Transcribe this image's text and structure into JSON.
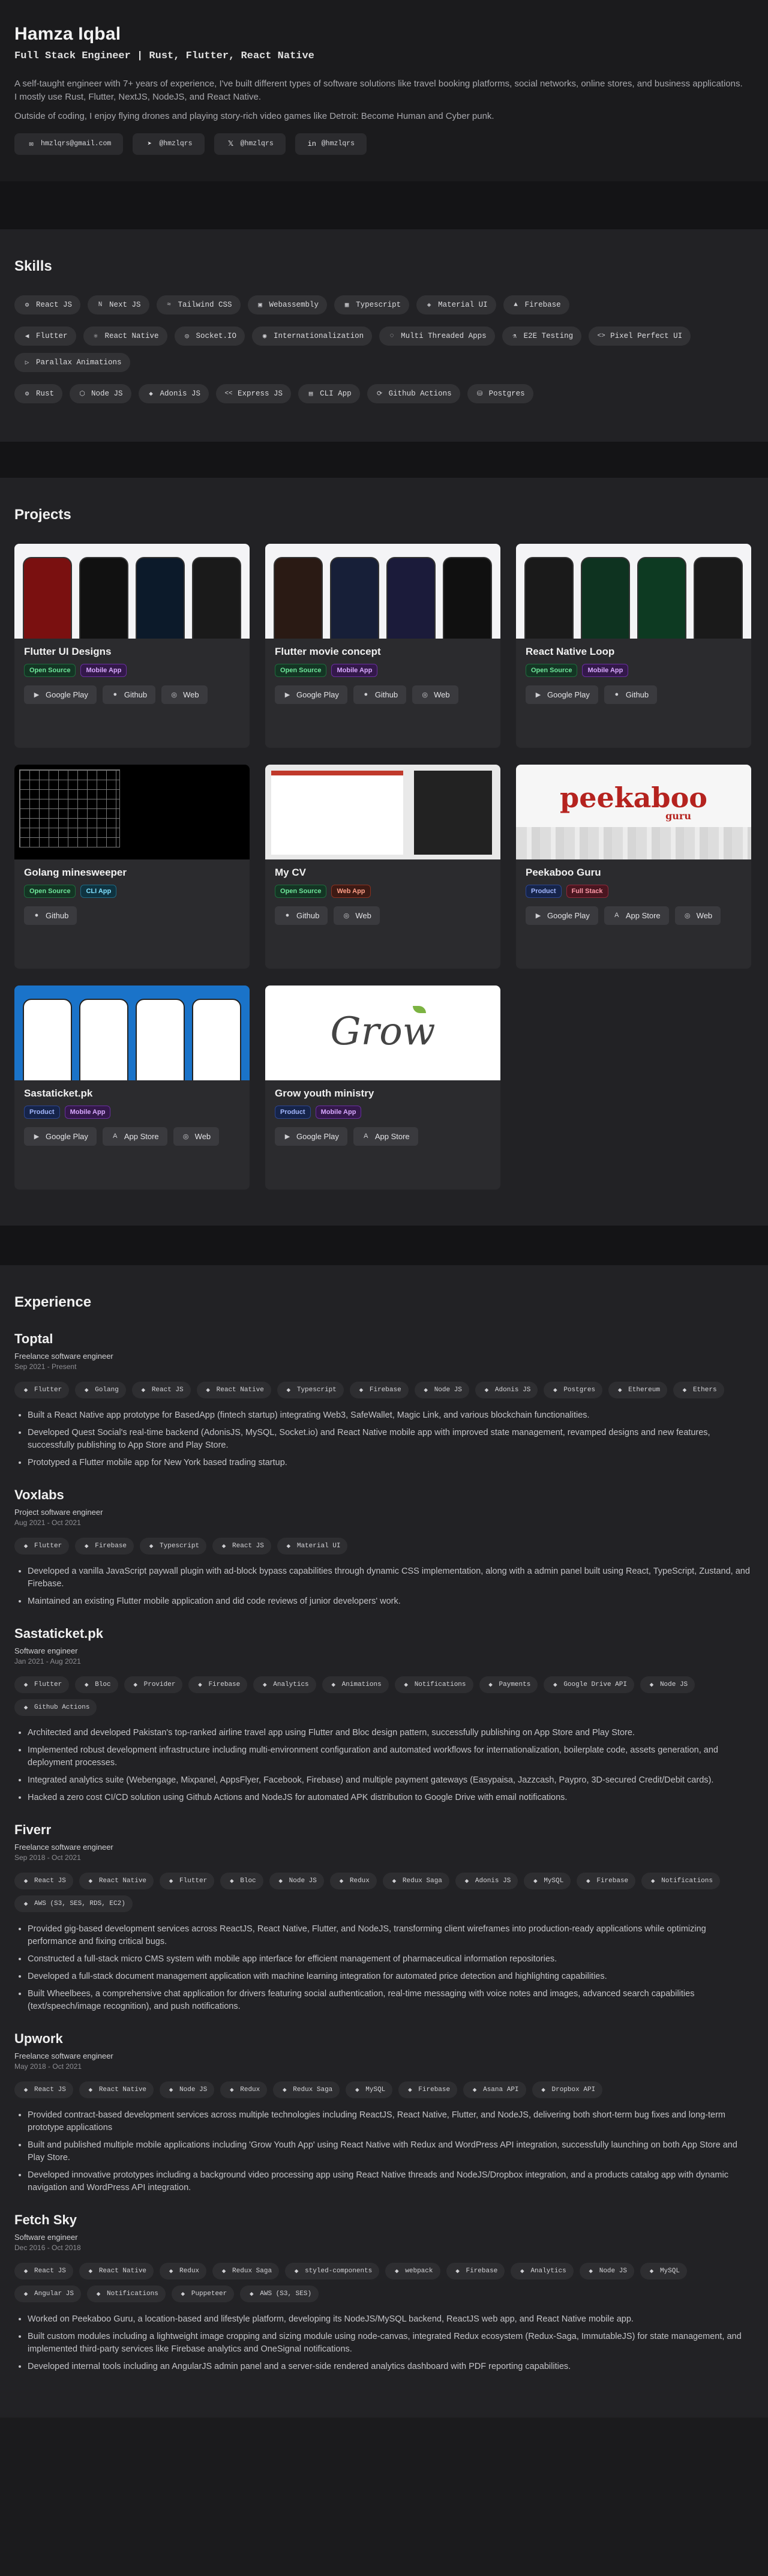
{
  "header": {
    "name": "Hamza Iqbal",
    "tagline": "Full Stack Engineer | Rust, Flutter, React Native",
    "bio": "A self-taught engineer with 7+ years of experience, I've built different types of software solutions like travel booking platforms, social networks, online stores, and business applications. I mostly use Rust, Flutter, NextJS, NodeJS, and React Native.",
    "bio2": "Outside of coding, I enjoy flying drones and playing story-rich video games like Detroit: Become Human and Cyber punk.",
    "contacts": [
      {
        "icon": "mail-icon",
        "glyph": "✉",
        "label": "hmzlqrs@gmail.com"
      },
      {
        "icon": "telegram-icon",
        "glyph": "➤",
        "label": "@hmzlqrs"
      },
      {
        "icon": "x-icon",
        "glyph": "𝕏",
        "label": "@hmzlqrs"
      },
      {
        "icon": "linkedin-icon",
        "glyph": "in",
        "label": "@hmzlqrs"
      }
    ]
  },
  "skills": {
    "title": "Skills",
    "rows": [
      [
        {
          "icon": "rust-icon",
          "glyph": "⚙",
          "label": "React JS"
        },
        {
          "icon": "next-icon",
          "glyph": "N",
          "label": "Next JS"
        },
        {
          "icon": "tailwind-icon",
          "glyph": "≈",
          "label": "Tailwind CSS"
        },
        {
          "icon": "wasm-icon",
          "glyph": "▣",
          "label": "Webassembly"
        },
        {
          "icon": "ts-icon",
          "glyph": "▦",
          "label": "Typescript"
        },
        {
          "icon": "mui-icon",
          "glyph": "◈",
          "label": "Material UI"
        },
        {
          "icon": "firebase-icon",
          "glyph": "▲",
          "label": "Firebase"
        }
      ],
      [
        {
          "icon": "flutter-icon",
          "glyph": "◀",
          "label": "Flutter"
        },
        {
          "icon": "react-icon",
          "glyph": "⚛",
          "label": "React Native"
        },
        {
          "icon": "socket-icon",
          "glyph": "◎",
          "label": "Socket.IO"
        },
        {
          "icon": "i18n-icon",
          "glyph": "◉",
          "label": "Internationalization"
        },
        {
          "icon": "threads-icon",
          "glyph": "◌",
          "label": "Multi Threaded Apps"
        },
        {
          "icon": "flask-icon",
          "glyph": "⚗",
          "label": "E2E Testing"
        },
        {
          "icon": "code-icon",
          "glyph": "<>",
          "label": "Pixel Perfect UI"
        },
        {
          "icon": "play-icon",
          "glyph": "▷",
          "label": "Parallax Animations"
        }
      ],
      [
        {
          "icon": "rust-icon",
          "glyph": "⚙",
          "label": "Rust"
        },
        {
          "icon": "node-icon",
          "glyph": "⬡",
          "label": "Node JS"
        },
        {
          "icon": "adonis-icon",
          "glyph": "◆",
          "label": "Adonis JS"
        },
        {
          "icon": "express-icon",
          "glyph": "<<",
          "label": "Express JS"
        },
        {
          "icon": "cli-icon",
          "glyph": "▤",
          "label": "CLI App"
        },
        {
          "icon": "gh-actions-icon",
          "glyph": "⟳",
          "label": "Github Actions"
        },
        {
          "icon": "postgres-icon",
          "glyph": "⛁",
          "label": "Postgres"
        }
      ]
    ]
  },
  "projects": {
    "title": "Projects",
    "items": [
      {
        "title": "Flutter UI Designs",
        "thumb": "phones",
        "tags": [
          {
            "cls": "os",
            "label": "Open Source"
          },
          {
            "cls": "mob",
            "label": "Mobile App"
          }
        ],
        "buttons": [
          {
            "icon": "play-store-icon",
            "glyph": "▶",
            "label": "Google Play"
          },
          {
            "icon": "github-icon",
            "glyph": "●",
            "label": "Github"
          },
          {
            "icon": "web-icon",
            "glyph": "◎",
            "label": "Web"
          }
        ]
      },
      {
        "title": "Flutter movie concept",
        "thumb": "phones2",
        "tags": [
          {
            "cls": "os",
            "label": "Open Source"
          },
          {
            "cls": "mob",
            "label": "Mobile App"
          }
        ],
        "buttons": [
          {
            "icon": "play-store-icon",
            "glyph": "▶",
            "label": "Google Play"
          },
          {
            "icon": "github-icon",
            "glyph": "●",
            "label": "Github"
          },
          {
            "icon": "web-icon",
            "glyph": "◎",
            "label": "Web"
          }
        ]
      },
      {
        "title": "React Native Loop",
        "thumb": "loop",
        "tags": [
          {
            "cls": "os",
            "label": "Open Source"
          },
          {
            "cls": "mob",
            "label": "Mobile App"
          }
        ],
        "buttons": [
          {
            "icon": "play-store-icon",
            "glyph": "▶",
            "label": "Google Play"
          },
          {
            "icon": "github-icon",
            "glyph": "●",
            "label": "Github"
          }
        ]
      },
      {
        "title": "Golang minesweeper",
        "thumb": "mines",
        "tags": [
          {
            "cls": "os",
            "label": "Open Source"
          },
          {
            "cls": "cli",
            "label": "CLI App"
          }
        ],
        "buttons": [
          {
            "icon": "github-icon",
            "glyph": "●",
            "label": "Github"
          }
        ]
      },
      {
        "title": "My CV",
        "thumb": "cv",
        "tags": [
          {
            "cls": "os",
            "label": "Open Source"
          },
          {
            "cls": "web",
            "label": "Web App"
          }
        ],
        "buttons": [
          {
            "icon": "github-icon",
            "glyph": "●",
            "label": "Github"
          },
          {
            "icon": "web-icon",
            "glyph": "◎",
            "label": "Web"
          }
        ]
      },
      {
        "title": "Peekaboo Guru",
        "thumb": "peekaboo",
        "logo_text": "peekaboo",
        "logo_sub": "guru",
        "tags": [
          {
            "cls": "prod",
            "label": "Product"
          },
          {
            "cls": "full",
            "label": "Full Stack"
          }
        ],
        "buttons": [
          {
            "icon": "play-store-icon",
            "glyph": "▶",
            "label": "Google Play"
          },
          {
            "icon": "app-store-icon",
            "glyph": "A",
            "label": "App Store"
          },
          {
            "icon": "web-icon",
            "glyph": "◎",
            "label": "Web"
          }
        ]
      },
      {
        "title": "Sastaticket.pk",
        "thumb": "sasta",
        "tags": [
          {
            "cls": "prod",
            "label": "Product"
          },
          {
            "cls": "mob",
            "label": "Mobile App"
          }
        ],
        "buttons": [
          {
            "icon": "play-store-icon",
            "glyph": "▶",
            "label": "Google Play"
          },
          {
            "icon": "app-store-icon",
            "glyph": "A",
            "label": "App Store"
          },
          {
            "icon": "web-icon",
            "glyph": "◎",
            "label": "Web"
          }
        ]
      },
      {
        "title": "Grow youth ministry",
        "thumb": "grow",
        "logo_text": "Grow",
        "tags": [
          {
            "cls": "prod",
            "label": "Product"
          },
          {
            "cls": "mob",
            "label": "Mobile App"
          }
        ],
        "buttons": [
          {
            "icon": "play-store-icon",
            "glyph": "▶",
            "label": "Google Play"
          },
          {
            "icon": "app-store-icon",
            "glyph": "A",
            "label": "App Store"
          }
        ]
      }
    ]
  },
  "experience": {
    "title": "Experience",
    "items": [
      {
        "company": "Toptal",
        "role": "Freelance software engineer",
        "dates": "Sep 2021 - Present",
        "chips": [
          "Flutter",
          "Golang",
          "React JS",
          "React Native",
          "Typescript",
          "Firebase",
          "Node JS",
          "Adonis JS",
          "Postgres",
          "Ethereum",
          "Ethers"
        ],
        "bullets": [
          "Built a React Native app prototype for BasedApp (fintech startup) integrating Web3, SafeWallet, Magic Link, and various blockchain functionalities.",
          "Developed Quest Social's real-time backend (AdonisJS, MySQL, Socket.io) and React Native mobile app with improved state management, revamped designs and new features, successfully publishing to App Store and Play Store.",
          "Prototyped a Flutter mobile app for New York based trading startup."
        ]
      },
      {
        "company": "Voxlabs",
        "role": "Project software engineer",
        "dates": "Aug 2021 - Oct 2021",
        "chips": [
          "Flutter",
          "Firebase",
          "Typescript",
          "React JS",
          "Material UI"
        ],
        "bullets": [
          "Developed a vanilla JavaScript paywall plugin with ad-block bypass capabilities through dynamic CSS implementation, along with a admin panel built using React, TypeScript, Zustand, and Firebase.",
          "Maintained an existing Flutter mobile application and did code reviews of junior developers' work."
        ]
      },
      {
        "company": "Sastaticket.pk",
        "role": "Software engineer",
        "dates": "Jan 2021 - Aug 2021",
        "chips": [
          "Flutter",
          "Bloc",
          "Provider",
          "Firebase",
          "Analytics",
          "Animations",
          "Notifications",
          "Payments",
          "Google Drive API",
          "Node JS",
          "Github Actions"
        ],
        "bullets": [
          "Architected and developed Pakistan's top-ranked airline travel app using Flutter and Bloc design pattern, successfully publishing on App Store and Play Store.",
          "Implemented robust development infrastructure including multi-environment configuration and automated workflows for internationalization, boilerplate code, assets generation, and deployment processes.",
          "Integrated analytics suite (Webengage, Mixpanel, AppsFlyer, Facebook, Firebase) and multiple payment gateways (Easypaisa, Jazzcash, Paypro, 3D-secured Credit/Debit cards).",
          "Hacked a zero cost CI/CD solution using Github Actions and NodeJS for automated APK distribution to Google Drive with email notifications."
        ]
      },
      {
        "company": "Fiverr",
        "role": "Freelance software engineer",
        "dates": "Sep 2018 - Oct 2021",
        "chips": [
          "React JS",
          "React Native",
          "Flutter",
          "Bloc",
          "Node JS",
          "Redux",
          "Redux Saga",
          "Adonis JS",
          "MySQL",
          "Firebase",
          "Notifications",
          "AWS (S3, SES, RDS, EC2)"
        ],
        "bullets": [
          "Provided gig-based development services across ReactJS, React Native, Flutter, and NodeJS, transforming client wireframes into production-ready applications while optimizing performance and fixing critical bugs.",
          "Constructed a full-stack micro CMS system with mobile app interface for efficient management of pharmaceutical information repositories.",
          "Developed a full-stack document management application with machine learning integration for automated price detection and highlighting capabilities.",
          "Built Wheelbees, a comprehensive chat application for drivers featuring social authentication, real-time messaging with voice notes and images, advanced search capabilities (text/speech/image recognition), and push notifications."
        ]
      },
      {
        "company": "Upwork",
        "role": "Freelance software engineer",
        "dates": "May 2018 - Oct 2021",
        "chips": [
          "React JS",
          "React Native",
          "Node JS",
          "Redux",
          "Redux Saga",
          "MySQL",
          "Firebase",
          "Asana API",
          "Dropbox API"
        ],
        "bullets": [
          "Provided contract-based development services across multiple technologies including ReactJS, React Native, Flutter, and NodeJS, delivering both short-term bug fixes and long-term prototype applications",
          "Built and published multiple mobile applications including 'Grow Youth App' using React Native with Redux and WordPress API integration, successfully launching on both App Store and Play Store.",
          "Developed innovative prototypes including a background video processing app using React Native threads and NodeJS/Dropbox integration, and a products catalog app with dynamic navigation and WordPress API integration."
        ]
      },
      {
        "company": "Fetch Sky",
        "role": "Software engineer",
        "dates": "Dec 2016 - Oct 2018",
        "chips": [
          "React JS",
          "React Native",
          "Redux",
          "Redux Saga",
          "styled-components",
          "webpack",
          "Firebase",
          "Analytics",
          "Node JS",
          "MySQL",
          "Angular JS",
          "Notifications",
          "Puppeteer",
          "AWS (S3, SES)"
        ],
        "bullets": [
          "Worked on Peekaboo Guru, a location-based and lifestyle platform, developing its NodeJS/MySQL backend, ReactJS web app, and React Native mobile app.",
          "Built custom modules including a lightweight image cropping and sizing module using node-canvas, integrated Redux ecosystem (Redux-Saga, ImmutableJS) for state management, and implemented third-party services like Firebase analytics and OneSignal notifications.",
          "Developed internal tools including an AngularJS admin panel and a server-side rendered analytics dashboard with PDF reporting capabilities."
        ]
      }
    ]
  }
}
